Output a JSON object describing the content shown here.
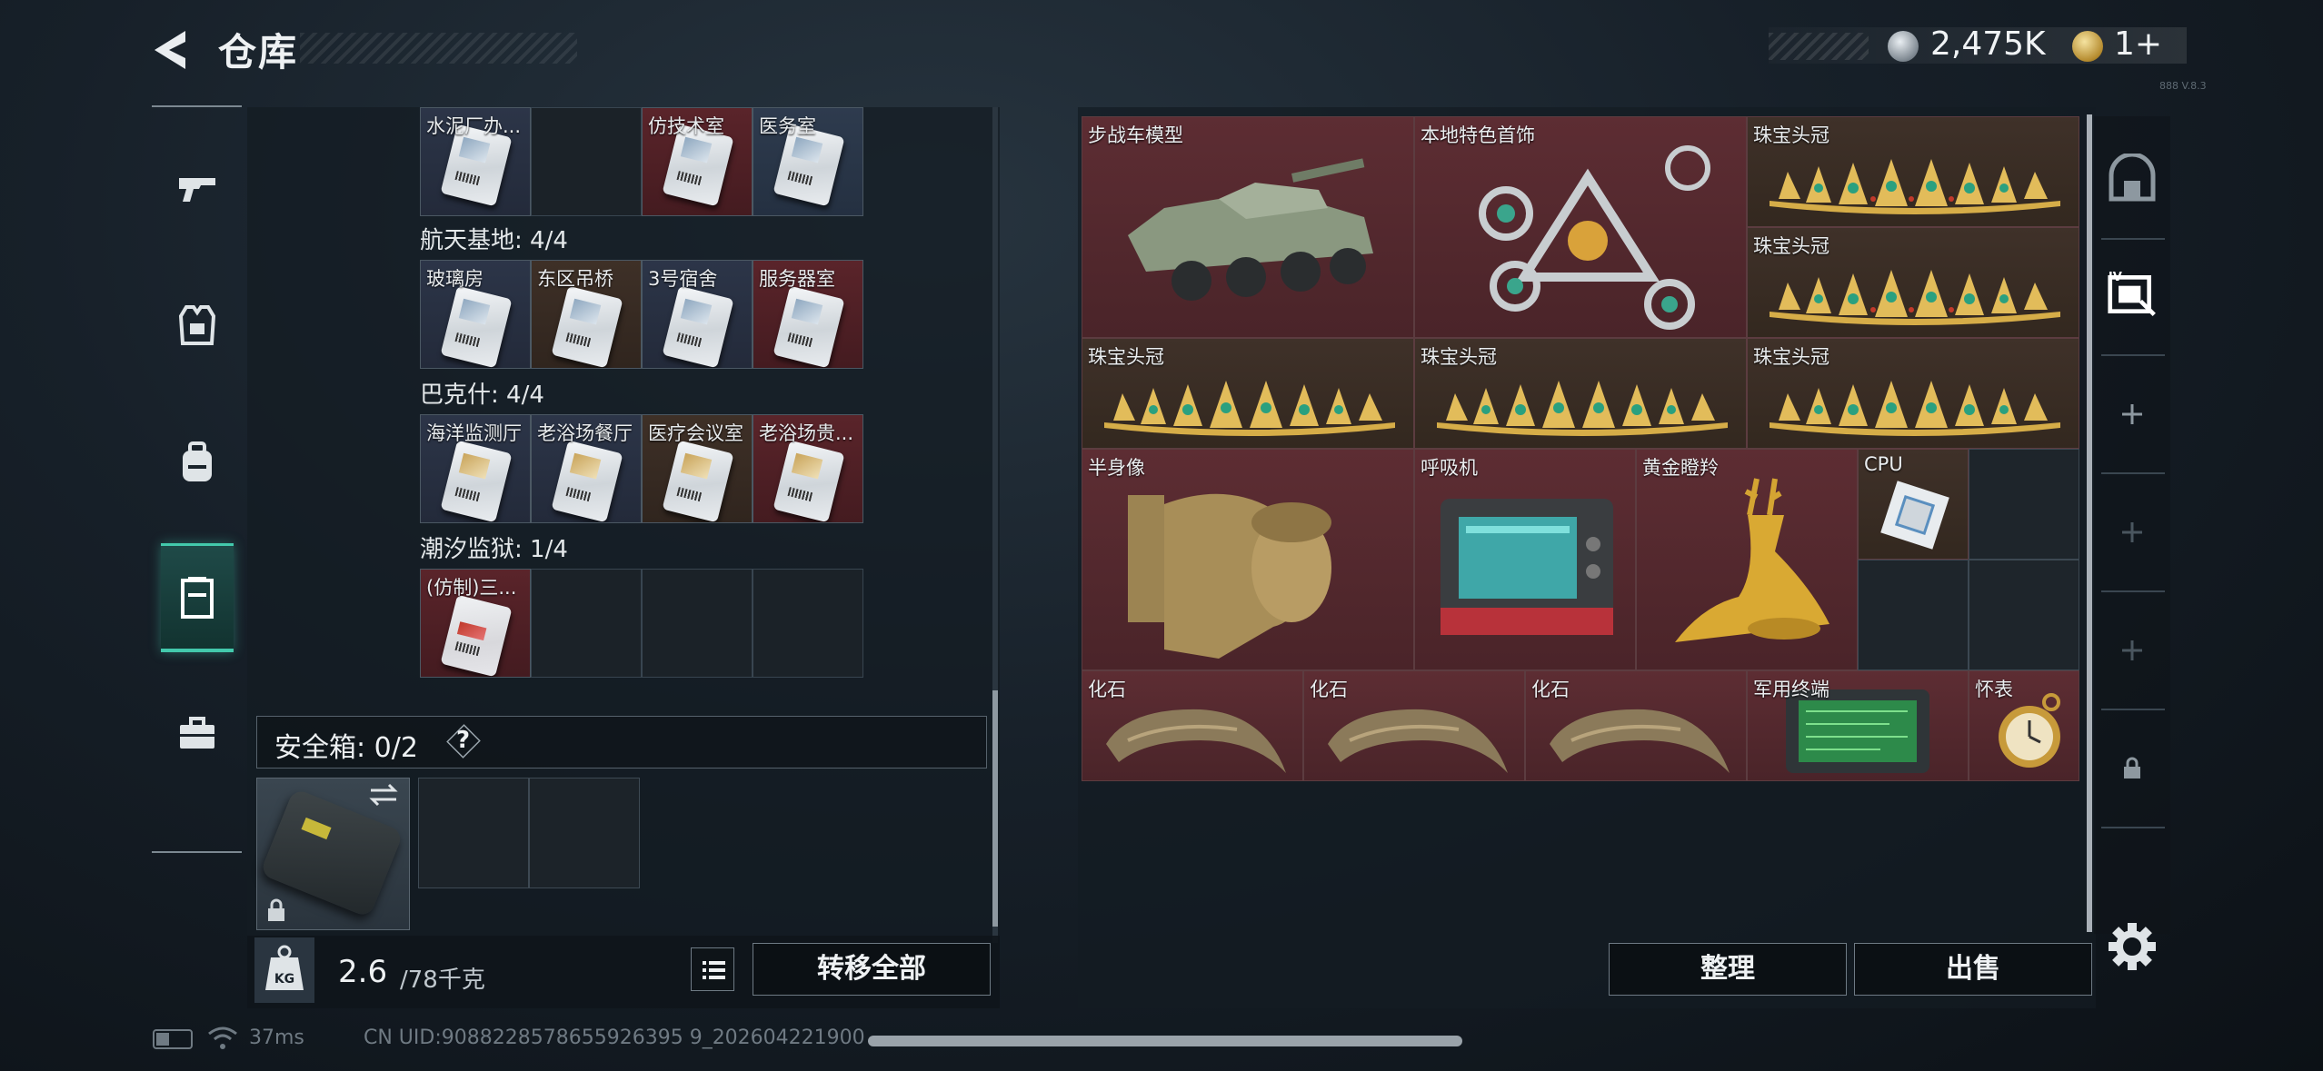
{
  "header": {
    "title": "仓库",
    "silver_amount": "2,475K",
    "gold_amount": "1+",
    "version_mark": "888 V.8.3"
  },
  "nav": {
    "items": [
      {
        "name": "weapons",
        "icon": "gun-icon"
      },
      {
        "name": "armor",
        "icon": "vest-icon"
      },
      {
        "name": "backpack",
        "icon": "backpack-icon"
      },
      {
        "name": "stash",
        "icon": "locker-icon",
        "active": true
      },
      {
        "name": "toolbox",
        "icon": "toolbox-icon"
      }
    ]
  },
  "stash": {
    "top_row": [
      "水泥厂办...",
      "",
      "仿技术室",
      "医务室"
    ],
    "regions": [
      {
        "title": "航天基地: 4/4",
        "cards": [
          "玻璃房",
          "东区吊桥",
          "3号宿舍",
          "服务器室"
        ]
      },
      {
        "title": "巴克什: 4/4",
        "cards": [
          "海洋监测厅",
          "老浴场餐厅",
          "医疗会议室",
          "老浴场贵..."
        ]
      },
      {
        "title": "潮汐监狱: 1/4",
        "cards": [
          "(仿制)三..."
        ]
      }
    ],
    "safe_box_label": "安全箱: 0/2",
    "safe_help": "?",
    "weight_value": "2.6",
    "weight_capacity": "/78千克",
    "weight_icon_text": "KG",
    "transfer_all_label": "转移全部"
  },
  "inventory": {
    "items": [
      {
        "label": "步战车模型",
        "icon": "armored-vehicle-icon"
      },
      {
        "label": "本地特色首饰",
        "icon": "jewelry-icon"
      },
      {
        "label": "珠宝头冠",
        "icon": "tiara-icon"
      },
      {
        "label": "珠宝头冠",
        "icon": "tiara-icon"
      },
      {
        "label": "珠宝头冠",
        "icon": "tiara-icon"
      },
      {
        "label": "珠宝头冠",
        "icon": "tiara-icon"
      },
      {
        "label": "珠宝头冠",
        "icon": "tiara-icon"
      },
      {
        "label": "半身像",
        "icon": "bust-icon"
      },
      {
        "label": "呼吸机",
        "icon": "ventilator-icon"
      },
      {
        "label": "黄金瞪羚",
        "icon": "gazelle-icon"
      },
      {
        "label": "CPU",
        "icon": "cpu-icon"
      },
      {
        "label": "化石",
        "icon": "fossil-claw-icon"
      },
      {
        "label": "化石",
        "icon": "fossil-claw-icon"
      },
      {
        "label": "化石",
        "icon": "fossil-claw-icon"
      },
      {
        "label": "军用终端",
        "icon": "terminal-icon"
      },
      {
        "label": "怀表",
        "icon": "pocket-watch-icon"
      }
    ],
    "sort_label": "整理",
    "sell_label": "出售"
  },
  "rail": {
    "items": [
      {
        "icon": "shelter-icon"
      },
      {
        "icon": "ticket-icon"
      },
      {
        "icon": "plus-icon"
      },
      {
        "icon": "plus-icon"
      },
      {
        "icon": "plus-icon"
      },
      {
        "icon": "lock-icon"
      }
    ]
  },
  "status": {
    "ping": "37ms",
    "uid": "CN UID:9088228578655926395 9_202604221900"
  },
  "colors": {
    "accent": "#43c9ac",
    "item_red": "#5d2d33",
    "item_brown": "#3f3129"
  }
}
